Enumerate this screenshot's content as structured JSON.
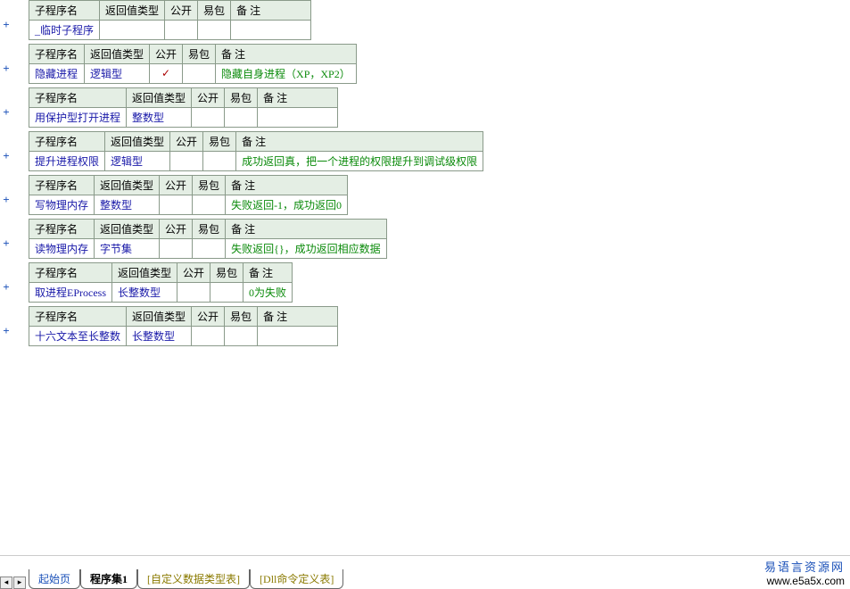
{
  "headers": {
    "name": "子程序名",
    "return_type": "返回值类型",
    "public": "公开",
    "easy_pkg": "易包",
    "remark": "备 注"
  },
  "subroutines": [
    {
      "name": "_临时子程序",
      "return_type": "",
      "public": "",
      "easy_pkg": "",
      "remark": ""
    },
    {
      "name": "隐藏进程",
      "return_type": "逻辑型",
      "public": "✓",
      "easy_pkg": "",
      "remark": "隐藏自身进程（XP，XP2）"
    },
    {
      "name": "用保护型打开进程",
      "return_type": "整数型",
      "public": "",
      "easy_pkg": "",
      "remark": ""
    },
    {
      "name": "提升进程权限",
      "return_type": "逻辑型",
      "public": "",
      "easy_pkg": "",
      "remark": "成功返回真，把一个进程的权限提升到调试级权限"
    },
    {
      "name": "写物理内存",
      "return_type": "整数型",
      "public": "",
      "easy_pkg": "",
      "remark": "失败返回-1，成功返回0"
    },
    {
      "name": "读物理内存",
      "return_type": "字节集",
      "public": "",
      "easy_pkg": "",
      "remark": "失败返回{}，成功返回相应数据"
    },
    {
      "name": "取进程EProcess",
      "return_type": "长整数型",
      "public": "",
      "easy_pkg": "",
      "remark": "0为失败"
    },
    {
      "name": "十六文本至长整数",
      "return_type": "长整数型",
      "public": "",
      "easy_pkg": "",
      "remark": ""
    }
  ],
  "tabs": {
    "start": "起始页",
    "program_set": "程序集1",
    "custom_type": "[自定义数据类型表]",
    "dll_cmd": "[Dll命令定义表]"
  },
  "branding": {
    "title": "易语言资源网",
    "url": "www.e5a5x.com"
  },
  "nav": {
    "prev": "◂",
    "next": "▸"
  }
}
